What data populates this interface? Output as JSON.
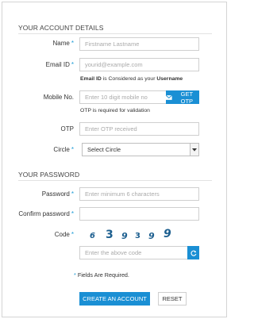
{
  "account": {
    "title": "YOUR ACCOUNT DETAILS",
    "name": {
      "label": "Name",
      "placeholder": "Firstname Lastname"
    },
    "email": {
      "label": "Email ID",
      "placeholder": "yourid@example.com",
      "hint_bold1": "Email ID",
      "hint_mid": " is Considered as your ",
      "hint_bold2": "Username"
    },
    "mobile": {
      "label": "Mobile No.",
      "placeholder": "Enter 10 digit mobile no",
      "button": "GET OTP",
      "hint": "OTP is required for validation"
    },
    "otp": {
      "label": "OTP",
      "placeholder": "Enter OTP received"
    },
    "circle": {
      "label": "Circle",
      "selected": "Select Circle"
    }
  },
  "password_section": {
    "title": "YOUR PASSWORD",
    "password": {
      "label": "Password",
      "placeholder": "Enter minimum 6 characters"
    },
    "confirm": {
      "label": "Confirm password"
    },
    "code": {
      "label": "Code",
      "digits": [
        "6",
        "3",
        "9",
        "3",
        "9",
        "9"
      ],
      "placeholder": "Enter the above code"
    }
  },
  "required_note": "Fields Are Required.",
  "required_mark": "*",
  "actions": {
    "create": "CREATE AN ACCOUNT",
    "reset": "RESET"
  },
  "colors": {
    "accent": "#1a8fd4",
    "required": "#1b9ad6",
    "captcha": "#1d5f8f"
  }
}
